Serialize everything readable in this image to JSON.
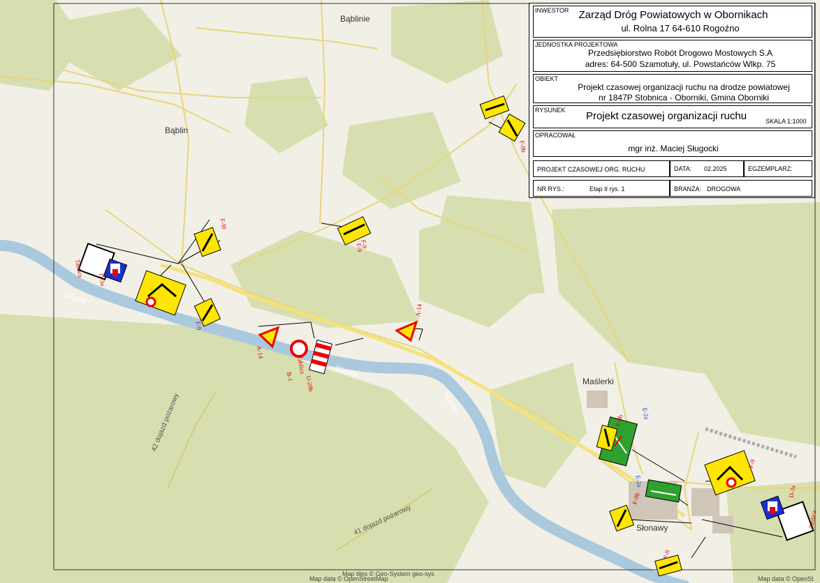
{
  "title_block": {
    "investor_label": "INWESTOR",
    "investor_name": "Zarząd Dróg Powiatowych w Obornikach",
    "investor_address": "ul. Rolna 17  64-610 Rogoźno",
    "designer_label": "JEDNOSTKA PROJEKTOWA",
    "designer_name": "Przedsiębiorstwo Robót Drogowo Mostowych S.A",
    "designer_address": "adres: 64-500 Szamotuły, ul. Powstańców Wlkp. 75",
    "object_label": "OBIEKT",
    "object_line1": "Projekt czasowej organizacji ruchu na drodze powiatowej",
    "object_line2": "nr 1847P Stobnica - Oborniki, Gmina Oborniki",
    "drawing_label": "RYSUNEK",
    "drawing_title": "Projekt czasowej organizacji ruchu",
    "scale": "SKALA  1:1000",
    "author_label": "OPRACOWAŁ",
    "author_name": "mgr inż. Maciej Sługocki",
    "project_type": "PROJEKT CZASOWEJ ORG. RUCHU",
    "date_label": "DATA:",
    "date_value": "02.2025",
    "copy_label": "EGZEMPLARZ:",
    "drawing_no_label": "NR RYS.:",
    "drawing_no_value": "Etap II rys. 1",
    "branch_label": "BRANŻA:",
    "branch_value": "DROGOWA"
  },
  "places": {
    "bablinie": "Bąblinie",
    "bablin": "Bąblin",
    "maslerki": "Maślerki",
    "slonawy": "Słonawy"
  },
  "rivers": {
    "warta1": "Warta",
    "warta2": "Warta",
    "warta3": "Warta"
  },
  "roads": {
    "fire_road_1": "42 dojazd pożarowy",
    "fire_road_2": "41 dojazd pożarowy"
  },
  "sign_codes": {
    "f9_a": "F-9f",
    "f9_b": "F-9b",
    "f9_c": "F-9",
    "f9_d": "F-9",
    "f9_e": "F-9",
    "f9_f": "F-9",
    "f9_g": "F-9b",
    "f9_h": "F-9b",
    "f9_i": "F-9",
    "a14_a": "A-14",
    "a14_b": "A-14",
    "b1": "B-1",
    "u20b": "U-20b",
    "tablica_a": "Tablica",
    "tablica_b": "Tablica",
    "d3_a": "D-3a",
    "d3_b": "D-3a",
    "e2a": "E-2a",
    "e2b": "E-2a"
  },
  "attribution": {
    "left": "Map data © OpenStreetMap",
    "left_top": "Map tiles © Geo-System geo-sys",
    "right": "Map data © OpenSt"
  },
  "colors": {
    "background": "#f2efe6",
    "forest": "#d7dfb0",
    "river": "#aac9df",
    "road": "#f4e27a",
    "sign_yellow": "#ffe600",
    "sign_green": "#2fa12f",
    "sign_blue": "#1d2fd1"
  }
}
